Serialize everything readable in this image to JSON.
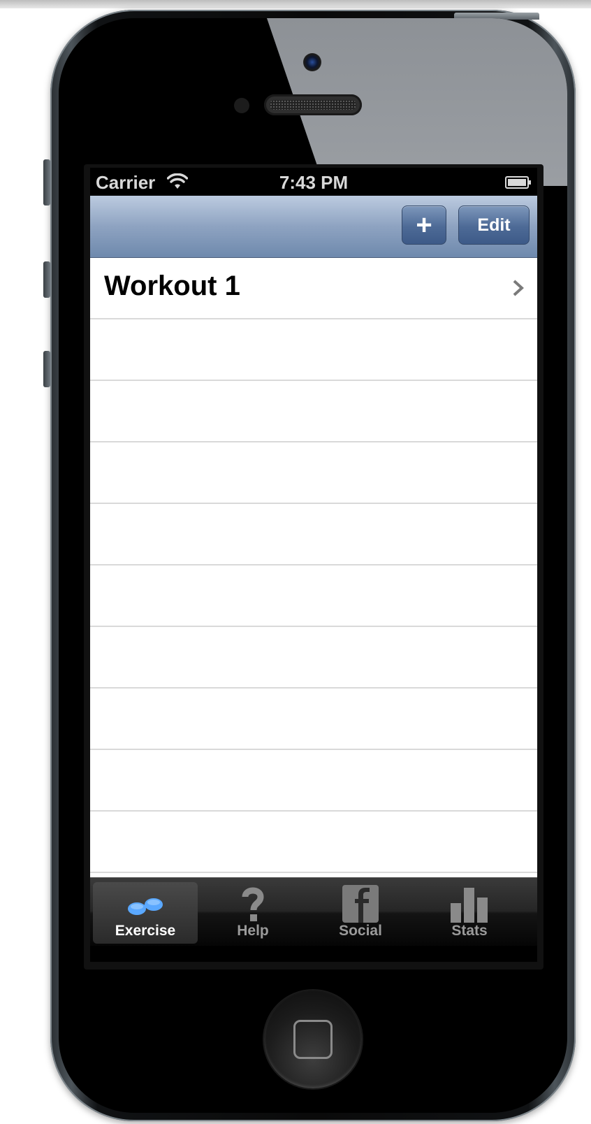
{
  "status_bar": {
    "carrier": "Carrier",
    "time": "7:43 PM",
    "wifi_icon": "wifi-icon",
    "battery_icon": "battery-icon"
  },
  "nav_bar": {
    "add_label": "+",
    "edit_label": "Edit"
  },
  "table": {
    "rows": [
      {
        "title": "Workout 1",
        "accessory": "chevron-right-icon"
      }
    ]
  },
  "tab_bar": {
    "tabs": [
      {
        "label": "Exercise",
        "icon": "dumbbell-icon",
        "selected": true
      },
      {
        "label": "Help",
        "icon": "question-mark-icon",
        "selected": false
      },
      {
        "label": "Social",
        "icon": "facebook-icon",
        "selected": false
      },
      {
        "label": "Stats",
        "icon": "bar-chart-icon",
        "selected": false
      }
    ]
  },
  "colors": {
    "nav_top": "#bccbe0",
    "nav_bottom": "#6e89ad",
    "button_blue": "#4d6a96",
    "active_tab_icon": "#5aa8ff"
  }
}
